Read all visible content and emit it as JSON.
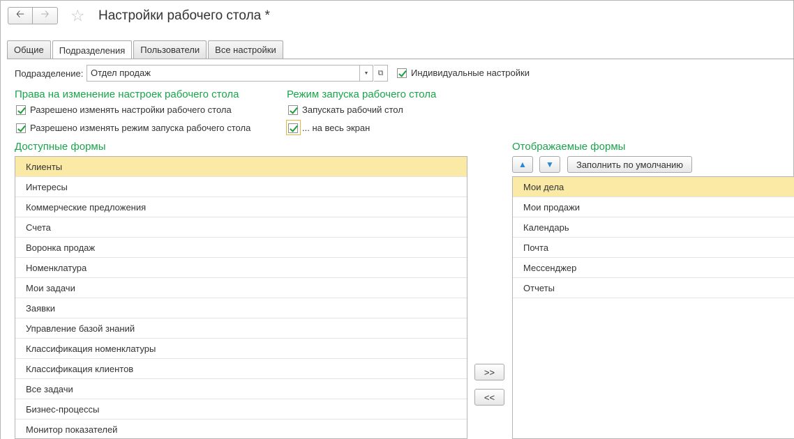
{
  "header": {
    "title": "Настройки рабочего стола *",
    "back_icon": "arrow-left-icon",
    "forward_icon": "arrow-right-icon",
    "star_icon": "star-icon"
  },
  "tabs": [
    {
      "label": "Общие"
    },
    {
      "label": "Подразделения"
    },
    {
      "label": "Пользователи"
    },
    {
      "label": "Все настройки"
    }
  ],
  "active_tab": "Подразделения",
  "subdivision": {
    "label": "Подразделение:",
    "value": "Отдел продаж",
    "individual_label": "Индивидуальные настройки"
  },
  "rights": {
    "title": "Права на изменение настроек рабочего стола",
    "change_settings": "Разрешено изменять настройки рабочего стола",
    "change_mode": "Разрешено изменять режим запуска рабочего стола"
  },
  "launch": {
    "title": "Режим запуска рабочего стола",
    "launch_desktop": "Запускать рабочий стол",
    "fullscreen": "... на весь экран"
  },
  "available": {
    "title": "Доступные формы",
    "items": [
      "Клиенты",
      "Интересы",
      "Коммерческие предложения",
      "Счета",
      "Воронка продаж",
      "Номенклатура",
      "Мои задачи",
      "Заявки",
      "Управление базой знаний",
      "Классификация номенклатуры",
      "Классификация клиентов",
      "Все задачи",
      "Бизнес-процессы",
      "Монитор показателей"
    ]
  },
  "move": {
    "add_label": ">>",
    "remove_label": "<<"
  },
  "displayed": {
    "title": "Отображаемые формы",
    "fill_default_label": "Заполнить по умолчанию",
    "items": [
      "Мои дела",
      "Мои продажи",
      "Календарь",
      "Почта",
      "Мессенджер",
      "Отчеты"
    ]
  },
  "colors": {
    "accent_green": "#1aa44b",
    "selection": "#fbeaa5",
    "arrow_blue": "#2a86d6"
  }
}
